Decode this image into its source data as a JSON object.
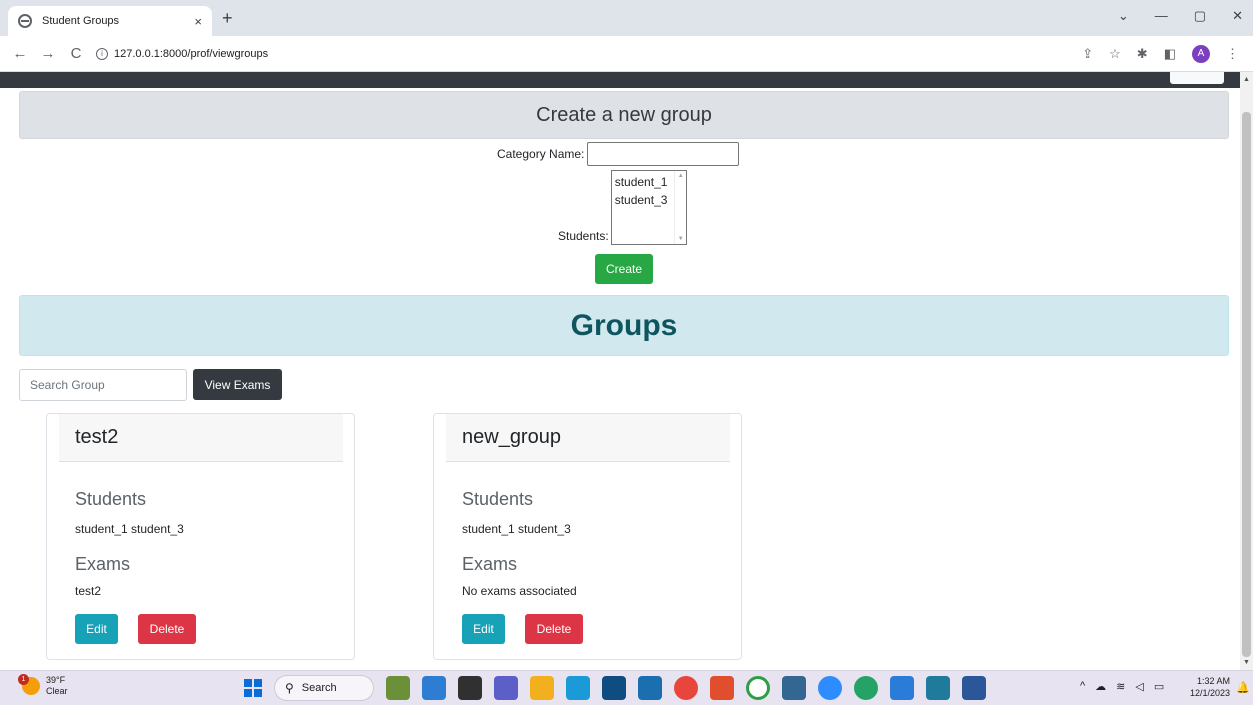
{
  "browser": {
    "tab_title": "Student Groups",
    "tab_close": "×",
    "new_tab": "+",
    "url": "127.0.0.1:8000/prof/viewgroups",
    "avatar_letter": "A"
  },
  "create_form": {
    "title": "Create a new group",
    "category_label": "Category Name:",
    "category_value": "",
    "students_label": "Students:",
    "student_options": [
      "student_1",
      "student_3"
    ],
    "create_button": "Create"
  },
  "groups_section": {
    "title": "Groups",
    "search_placeholder": "Search Group",
    "view_exams_button": "View Exams"
  },
  "groups": [
    {
      "name": "test2",
      "students_heading": "Students",
      "students": "student_1 student_3",
      "exams_heading": "Exams",
      "exams": "test2",
      "edit_label": "Edit",
      "delete_label": "Delete"
    },
    {
      "name": "new_group",
      "students_heading": "Students",
      "students": "student_1 student_3",
      "exams_heading": "Exams",
      "exams": "No exams associated",
      "edit_label": "Edit",
      "delete_label": "Delete"
    }
  ],
  "taskbar": {
    "weather_temp": "39°F",
    "weather_desc": "Clear",
    "weather_badge": "1",
    "search_label": "Search",
    "time": "1:32 AM",
    "date": "12/1/2023"
  },
  "colors": {
    "create_green": "#28a745",
    "edit_teal": "#17a2b8",
    "delete_red": "#dc3545",
    "groups_banner": "#d1e8ee",
    "groups_title": "#0f5560"
  }
}
